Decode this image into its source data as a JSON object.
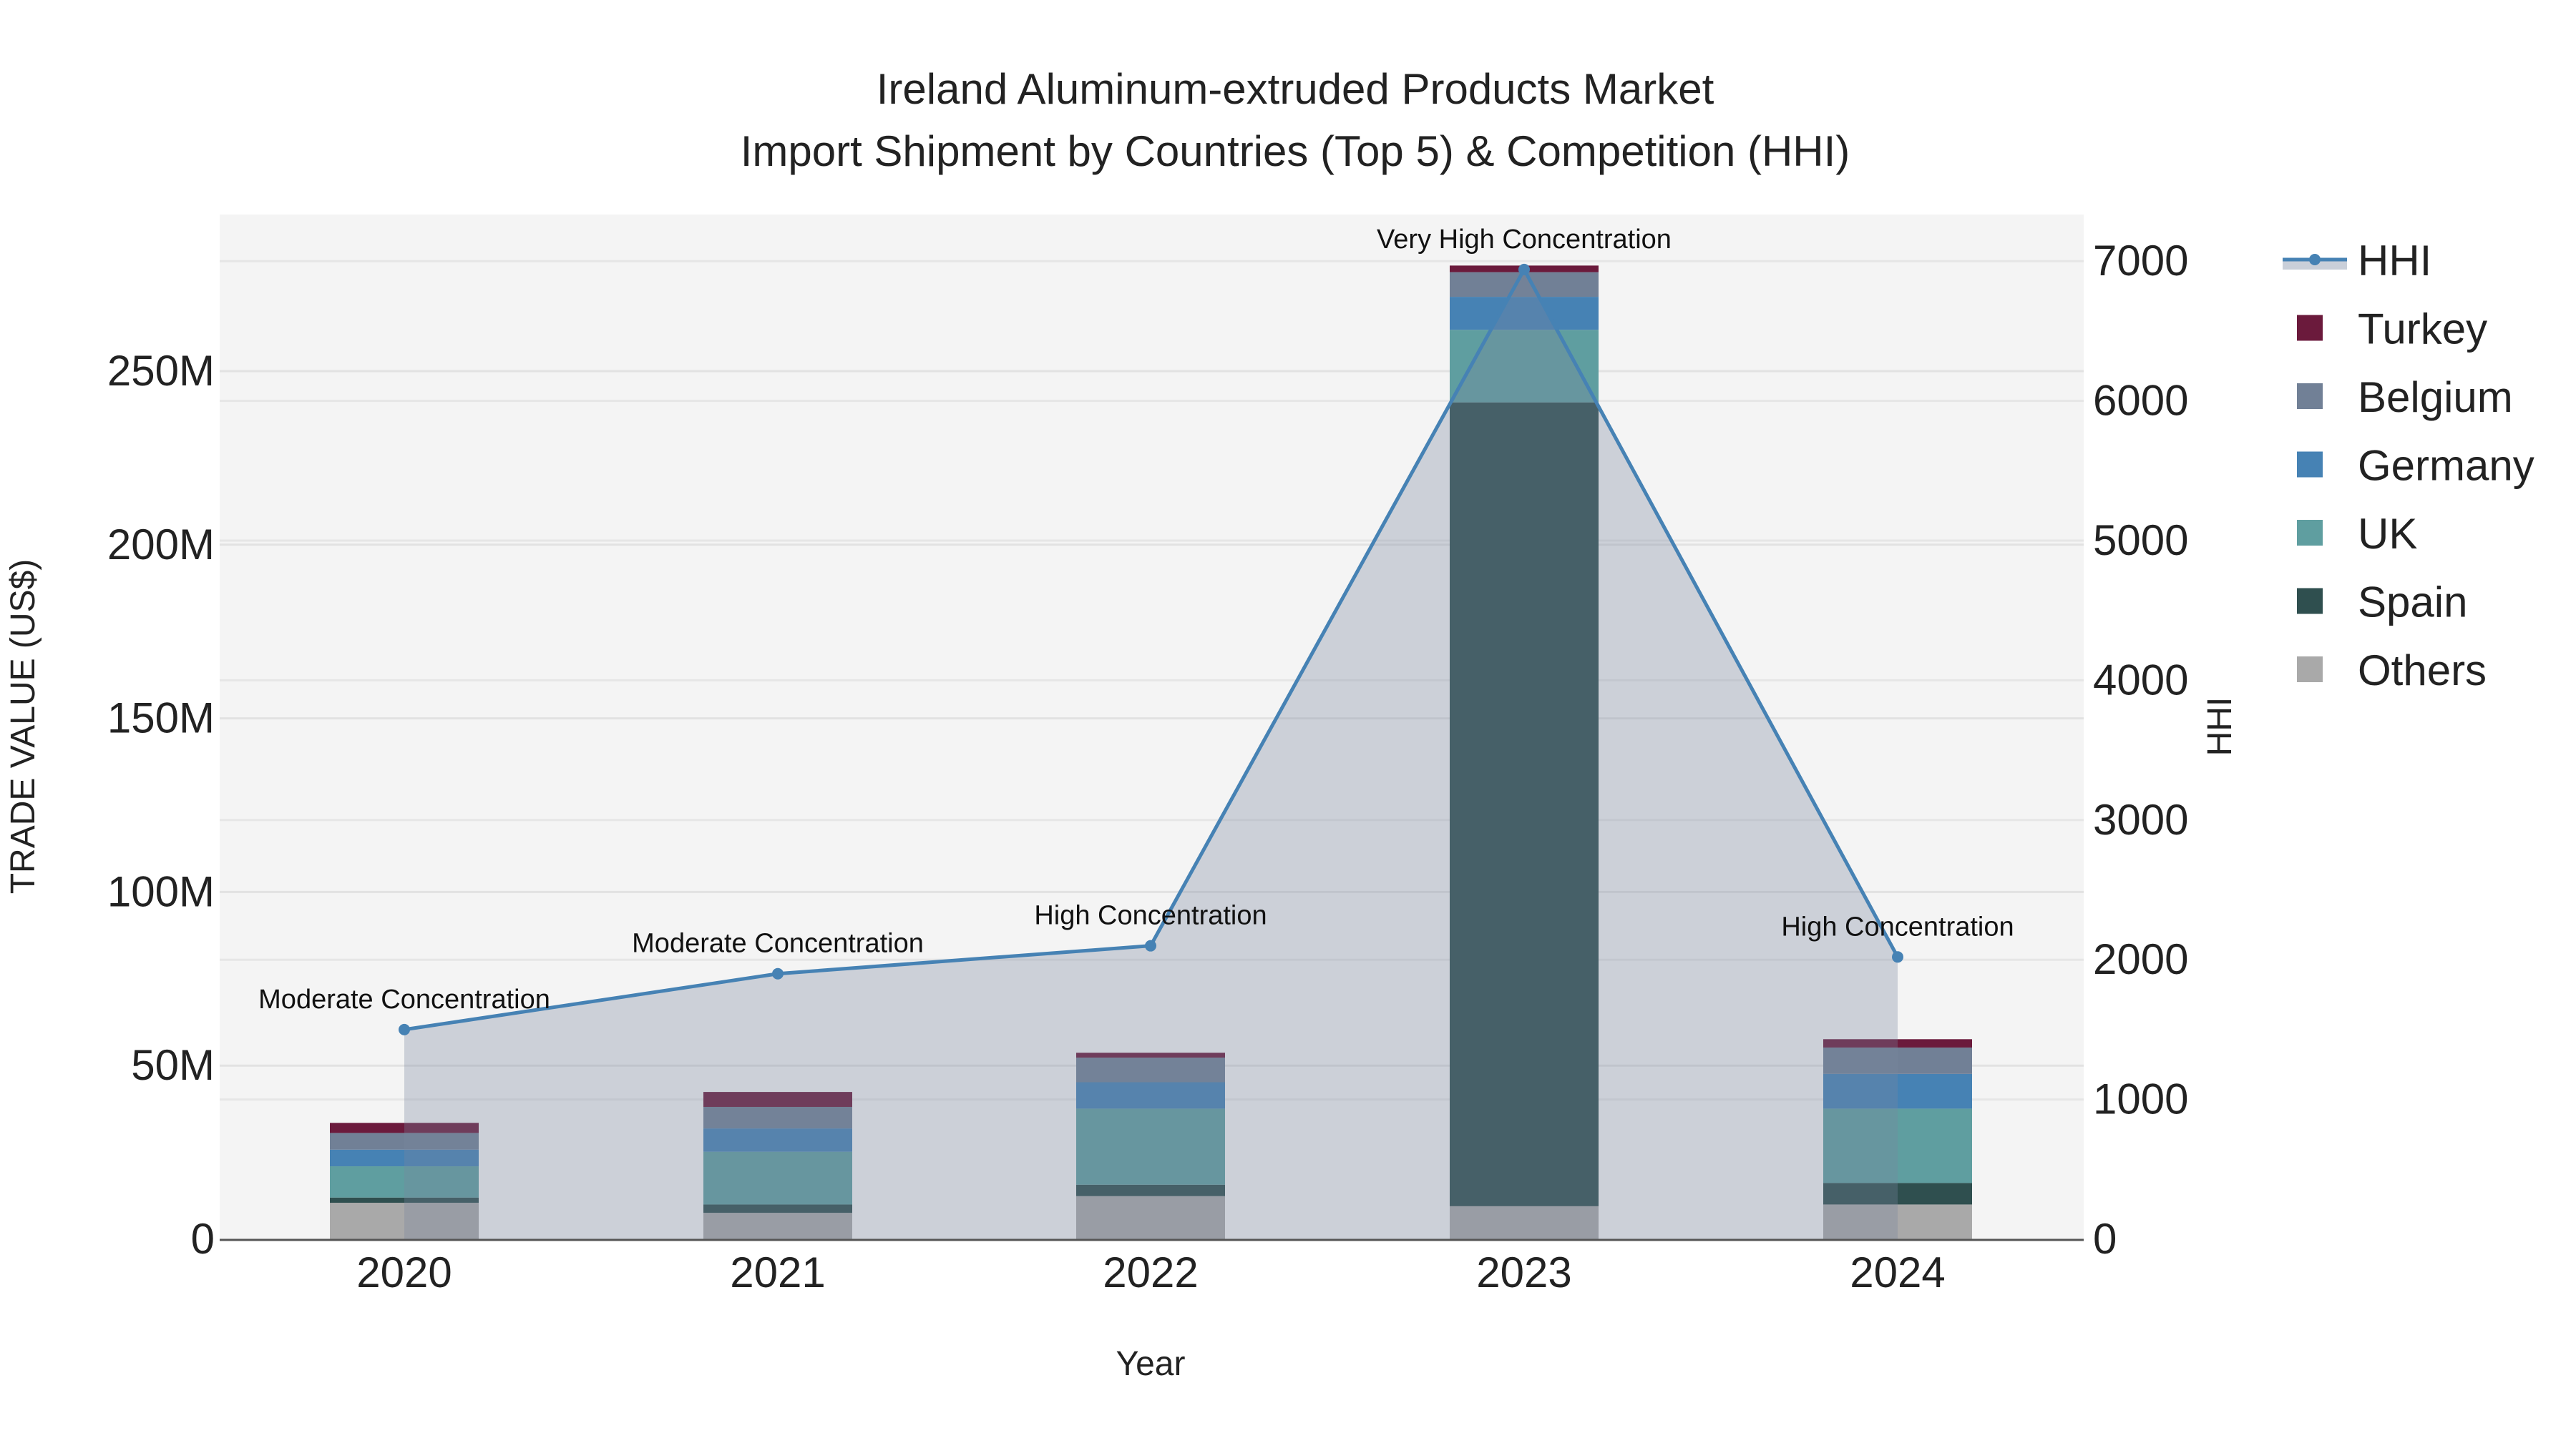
{
  "chart_data": {
    "type": "bar",
    "title_line1": "Ireland Aluminum-extruded Products Market",
    "title_line2": "Import Shipment by Countries (Top 5) & Competition (HHI)",
    "xlabel": "Year",
    "ylabel": "TRADE VALUE (US$)",
    "y2label": "HHI",
    "categories": [
      "2020",
      "2021",
      "2022",
      "2023",
      "2024"
    ],
    "ylim": [
      0,
      295
    ],
    "y_ticks": [
      0,
      50,
      100,
      150,
      200,
      250
    ],
    "y_tick_labels": [
      "0",
      "50M",
      "100M",
      "150M",
      "200M",
      "250M"
    ],
    "y2lim": [
      0,
      7300
    ],
    "y2_ticks": [
      0,
      1000,
      2000,
      3000,
      4000,
      5000,
      6000,
      7000
    ],
    "y2_tick_labels": [
      "0",
      "1000",
      "2000",
      "3000",
      "4000",
      "5000",
      "6000",
      "7000"
    ],
    "units": "US$ millions",
    "series": [
      {
        "name": "Others",
        "color": "#a9a9a9",
        "values": [
          10.5,
          7.6,
          12.4,
          9.5,
          10.0
        ]
      },
      {
        "name": "Spain",
        "color": "#2f4f4f",
        "values": [
          1.5,
          2.4,
          3.3,
          231.5,
          6.2
        ]
      },
      {
        "name": "UK",
        "color": "#5f9ea0",
        "values": [
          9.0,
          15.2,
          21.9,
          20.9,
          21.4
        ]
      },
      {
        "name": "Germany",
        "color": "#4682b4",
        "values": [
          4.8,
          6.7,
          7.6,
          9.5,
          10.0
        ]
      },
      {
        "name": "Belgium",
        "color": "#718096",
        "values": [
          4.8,
          6.2,
          7.1,
          7.1,
          7.6
        ]
      },
      {
        "name": "Turkey",
        "color": "#6b1a3c",
        "values": [
          2.9,
          4.3,
          1.4,
          1.9,
          2.4
        ]
      }
    ],
    "hhi": {
      "name": "HHI",
      "color": "#4682b4",
      "values": [
        1500,
        1900,
        2100,
        6940,
        2020
      ],
      "annotations": [
        "Moderate Concentration",
        "Moderate Concentration",
        "High Concentration",
        "Very High Concentration",
        "High Concentration"
      ]
    },
    "legend": [
      "HHI",
      "Turkey",
      "Belgium",
      "Germany",
      "UK",
      "Spain",
      "Others"
    ],
    "legend_placement": "right",
    "grid": true
  }
}
